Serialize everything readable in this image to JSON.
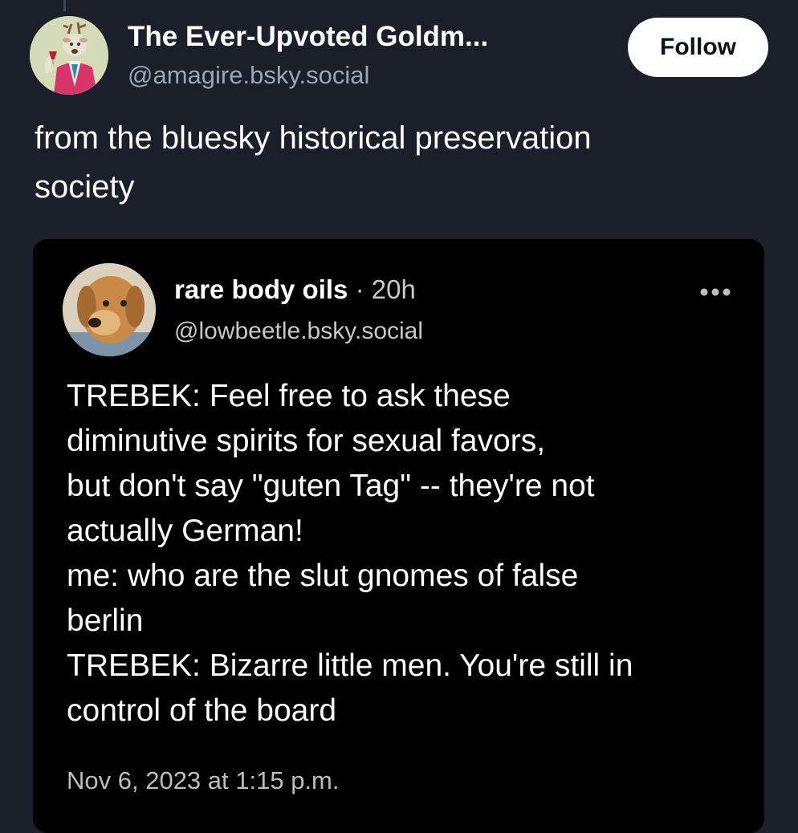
{
  "post": {
    "author_name": "The Ever-Upvoted Goldm...",
    "author_handle": "@amagire.bsky.social",
    "follow_label": "Follow",
    "text_line_1": "from the bluesky historical preservation",
    "text_line_2": "society"
  },
  "quote": {
    "author_name": "rare body oils",
    "separator": " · ",
    "time": "20h",
    "author_handle": "@lowbeetle.bsky.social",
    "body_lines": [
      "TREBEK: Feel free to ask these",
      "diminutive spirits for sexual favors,",
      "but don't say \"guten Tag\" -- they're not",
      "actually German!",
      "me: who are the slut gnomes of false",
      "berlin",
      "TREBEK: Bizarre little men. You're still in",
      "control of the board"
    ],
    "date": "Nov 6, 2023 at 1:15 p.m."
  },
  "colors": {
    "background": "#1a1f2a",
    "quote_background": "#000000",
    "handle_gray": "#9aa6b8",
    "follow_bg": "#ffffff"
  },
  "icons": {
    "more": "ellipsis-icon"
  }
}
